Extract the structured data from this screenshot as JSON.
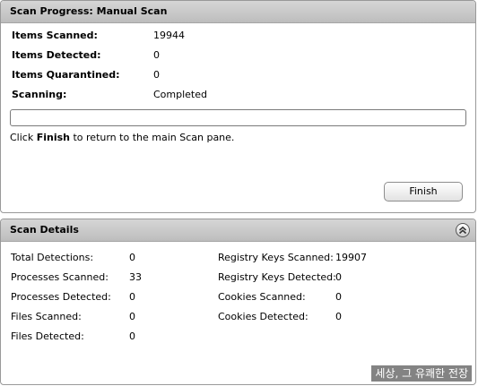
{
  "scan_progress": {
    "title": "Scan Progress: Manual Scan",
    "stats": [
      {
        "label": "Items Scanned:",
        "value": "19944"
      },
      {
        "label": "Items Detected:",
        "value": "0"
      },
      {
        "label": "Items Quarantined:",
        "value": "0"
      },
      {
        "label": "Scanning:",
        "value": "Completed"
      }
    ],
    "progress_fraction": 0,
    "instruction_prefix": "Click ",
    "instruction_bold": "Finish",
    "instruction_suffix": " to return to the main Scan pane.",
    "finish_label": "Finish"
  },
  "scan_details": {
    "title": "Scan Details",
    "collapse_icon": "double-chevron-up-icon",
    "left_items": [
      {
        "label": "Total Detections:",
        "value": "0"
      },
      {
        "label": "Processes Scanned:",
        "value": "33"
      },
      {
        "label": "Processes Detected:",
        "value": "0"
      },
      {
        "label": "Files Scanned:",
        "value": "0"
      },
      {
        "label": "Files Detected:",
        "value": "0"
      }
    ],
    "right_items": [
      {
        "label": "Registry Keys Scanned:",
        "value": "19907"
      },
      {
        "label": "Registry Keys Detected:",
        "value": "0"
      },
      {
        "label": "Cookies Scanned:",
        "value": "0"
      },
      {
        "label": "Cookies Detected:",
        "value": "0"
      }
    ]
  },
  "watermark": "세상, 그 유쾌한 전장",
  "colors": {
    "header_bg": "#c8c8c8",
    "panel_border": "#999999",
    "button_border": "#8e8e8e"
  }
}
